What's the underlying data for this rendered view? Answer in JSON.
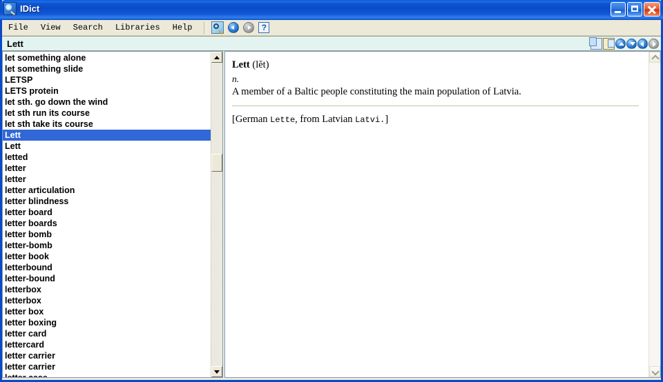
{
  "window": {
    "title": "IDict",
    "icon": "dictionary-magnifier-icon",
    "controls": {
      "minimize": "Minimize",
      "maximize": "Maximize",
      "close": "Close"
    }
  },
  "menubar": {
    "items": [
      {
        "label": "File"
      },
      {
        "label": "View"
      },
      {
        "label": "Search"
      },
      {
        "label": "Libraries"
      },
      {
        "label": "Help"
      }
    ],
    "toolbar_icons": [
      {
        "name": "search-icon",
        "tip": "Search"
      },
      {
        "name": "back-arrow-icon",
        "tip": "Back",
        "enabled": true
      },
      {
        "name": "forward-arrow-icon",
        "tip": "Forward",
        "enabled": false
      },
      {
        "name": "help-icon",
        "tip": "Help",
        "glyph": "?"
      }
    ]
  },
  "search": {
    "value": "Lett",
    "placeholder": "",
    "actions": [
      {
        "name": "copy-icon",
        "tip": "Copy"
      },
      {
        "name": "paste-icon",
        "tip": "Paste"
      },
      {
        "name": "scroll-up-icon",
        "tip": "Previous",
        "enabled": true
      },
      {
        "name": "scroll-down-icon",
        "tip": "Next",
        "enabled": true
      },
      {
        "name": "history-back-icon",
        "tip": "Back",
        "enabled": true
      },
      {
        "name": "history-forward-icon",
        "tip": "Forward",
        "enabled": false
      }
    ]
  },
  "wordlist": {
    "selected_index": 7,
    "items": [
      "let something alone",
      "let something slide",
      "LETSP",
      "LETS protein",
      "let sth. go down the wind",
      "let sth run its course",
      "let sth take its course",
      "Lett",
      "Lett",
      "letted",
      "letter",
      "letter",
      "letter articulation",
      "letter blindness",
      "letter board",
      "letter boards",
      "letter bomb",
      "letter-bomb",
      "letter book",
      "letterbound",
      "letter-bound",
      "letterbox",
      "letterbox",
      "letter box",
      "letter boxing",
      "letter card",
      "lettercard",
      "letter carrier",
      "letter carrier",
      "letter case"
    ]
  },
  "definition": {
    "headword": "Lett",
    "pronunciation": "(lĕt)",
    "part_of_speech": "n.",
    "sense": "A member of a Baltic people constituting the main population of Latvia.",
    "etymology": {
      "open": "[German ",
      "source_word_1": "Lette",
      "middle": ", from Latvian ",
      "source_word_2": "Latvi.",
      "close": "]"
    }
  },
  "colors": {
    "titlebar_blue": "#0b49c6",
    "selection_blue": "#3167d7",
    "search_background": "#e3f4f0",
    "chrome": "#ece9d8"
  }
}
